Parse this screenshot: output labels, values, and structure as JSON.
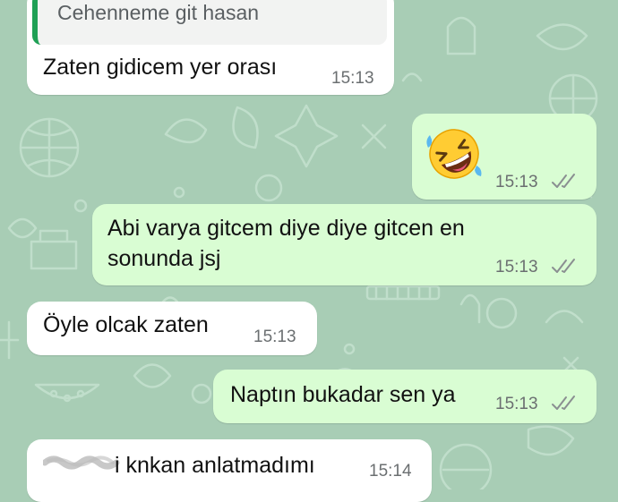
{
  "colors": {
    "wallpaper": "#a8cdb5",
    "incoming_bubble": "#ffffff",
    "outgoing_bubble": "#d9fdd3",
    "quote_bar": "#1fa055",
    "read_ticks": "#8a8f91"
  },
  "messages": [
    {
      "direction": "incoming",
      "quoted_text": "Cehenneme git hasan",
      "text": "Zaten gidicem yer orası",
      "time": "15:13"
    },
    {
      "direction": "outgoing",
      "emoji": "rolling-on-the-floor-laughing-emoji",
      "time": "15:13",
      "status": "read-ticks-icon"
    },
    {
      "direction": "outgoing",
      "text_line1": "Abi varya gitcem diye diye gitcen en",
      "text_line2": "sonunda jsj",
      "time": "15:13",
      "status": "read-ticks-icon"
    },
    {
      "direction": "incoming",
      "text": "Öyle olcak zaten",
      "time": "15:13"
    },
    {
      "direction": "outgoing",
      "text": "Naptın bukadar sen ya",
      "time": "15:13",
      "status": "read-ticks-icon"
    },
    {
      "direction": "incoming",
      "text": "i knkan anlatmadımı",
      "time": "15:14",
      "redacted_prefix": true
    }
  ]
}
